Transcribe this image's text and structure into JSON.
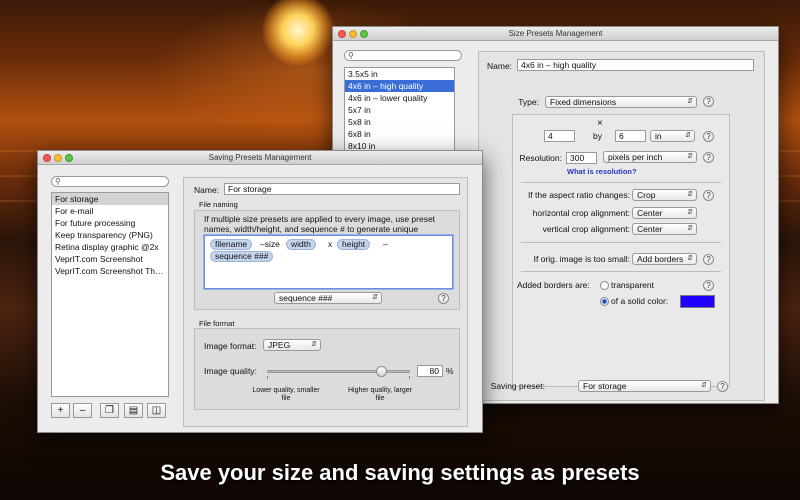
{
  "caption": "Save your size and saving settings as presets",
  "size_window": {
    "title": "Size Presets Management",
    "presets": [
      "3.5x5 in",
      "4x6 in – high quality",
      "4x6 in – lower quality",
      "5x7 in",
      "5x8 in",
      "6x8 in",
      "8x10 in"
    ],
    "selected_index": 1,
    "name_label": "Name:",
    "name_value": "4x6 in – high quality",
    "type_label": "Type:",
    "type_value": "Fixed dimensions",
    "times_symbol": "×",
    "width_value": "4",
    "by_label": "by",
    "height_value": "6",
    "units_value": "in",
    "resolution_label": "Resolution:",
    "resolution_value": "300",
    "resolution_units": "pixels per inch",
    "resolution_link": "What is resolution?",
    "aspect_label": "If the aspect ratio changes:",
    "aspect_value": "Crop",
    "hcrop_label": "horizontal crop alignment:",
    "hcrop_value": "Center",
    "vcrop_label": "vertical crop alignment:",
    "vcrop_value": "Center",
    "small_label": "If orig. image is too small:",
    "small_value": "Add borders",
    "borders_label": "Added borders are:",
    "transparent_label": "transparent",
    "solid_label": "of a solid color:",
    "solid_color": "#2200ff",
    "saving_label": "Saving preset:",
    "saving_value": "For storage",
    "help": "?"
  },
  "saving_window": {
    "title": "Saving Presets Management",
    "presets": [
      "For storage",
      "For e-mail",
      "For future processing",
      "Keep transparency (PNG)",
      "Retina display graphic @2x",
      "VeprIT.com Screenshot",
      "VeprIT.com Screenshot Th…"
    ],
    "selected_index": 0,
    "name_label": "Name:",
    "name_value": "For storage",
    "file_naming_label": "File naming",
    "file_naming_desc": "If multiple size presets are applied to every image, use preset names, width/height, and sequence # to generate unique filenames.",
    "tokens": {
      "filename": "filename",
      "sep1": "–size",
      "width": "width",
      "times": "x",
      "height": "height",
      "dash": "–",
      "sequence": "sequence ###"
    },
    "insert_popup": "sequence ###",
    "file_format_label": "File format",
    "image_format_label": "Image format:",
    "image_format_value": "JPEG",
    "quality_label": "Image quality:",
    "quality_value": "80",
    "quality_percent": "%",
    "quality_fraction": 0.8,
    "lower_quality": "Lower quality, smaller file",
    "higher_quality": "Higher quality, larger file",
    "buttons": {
      "add": "+",
      "remove": "–"
    },
    "help": "?"
  }
}
